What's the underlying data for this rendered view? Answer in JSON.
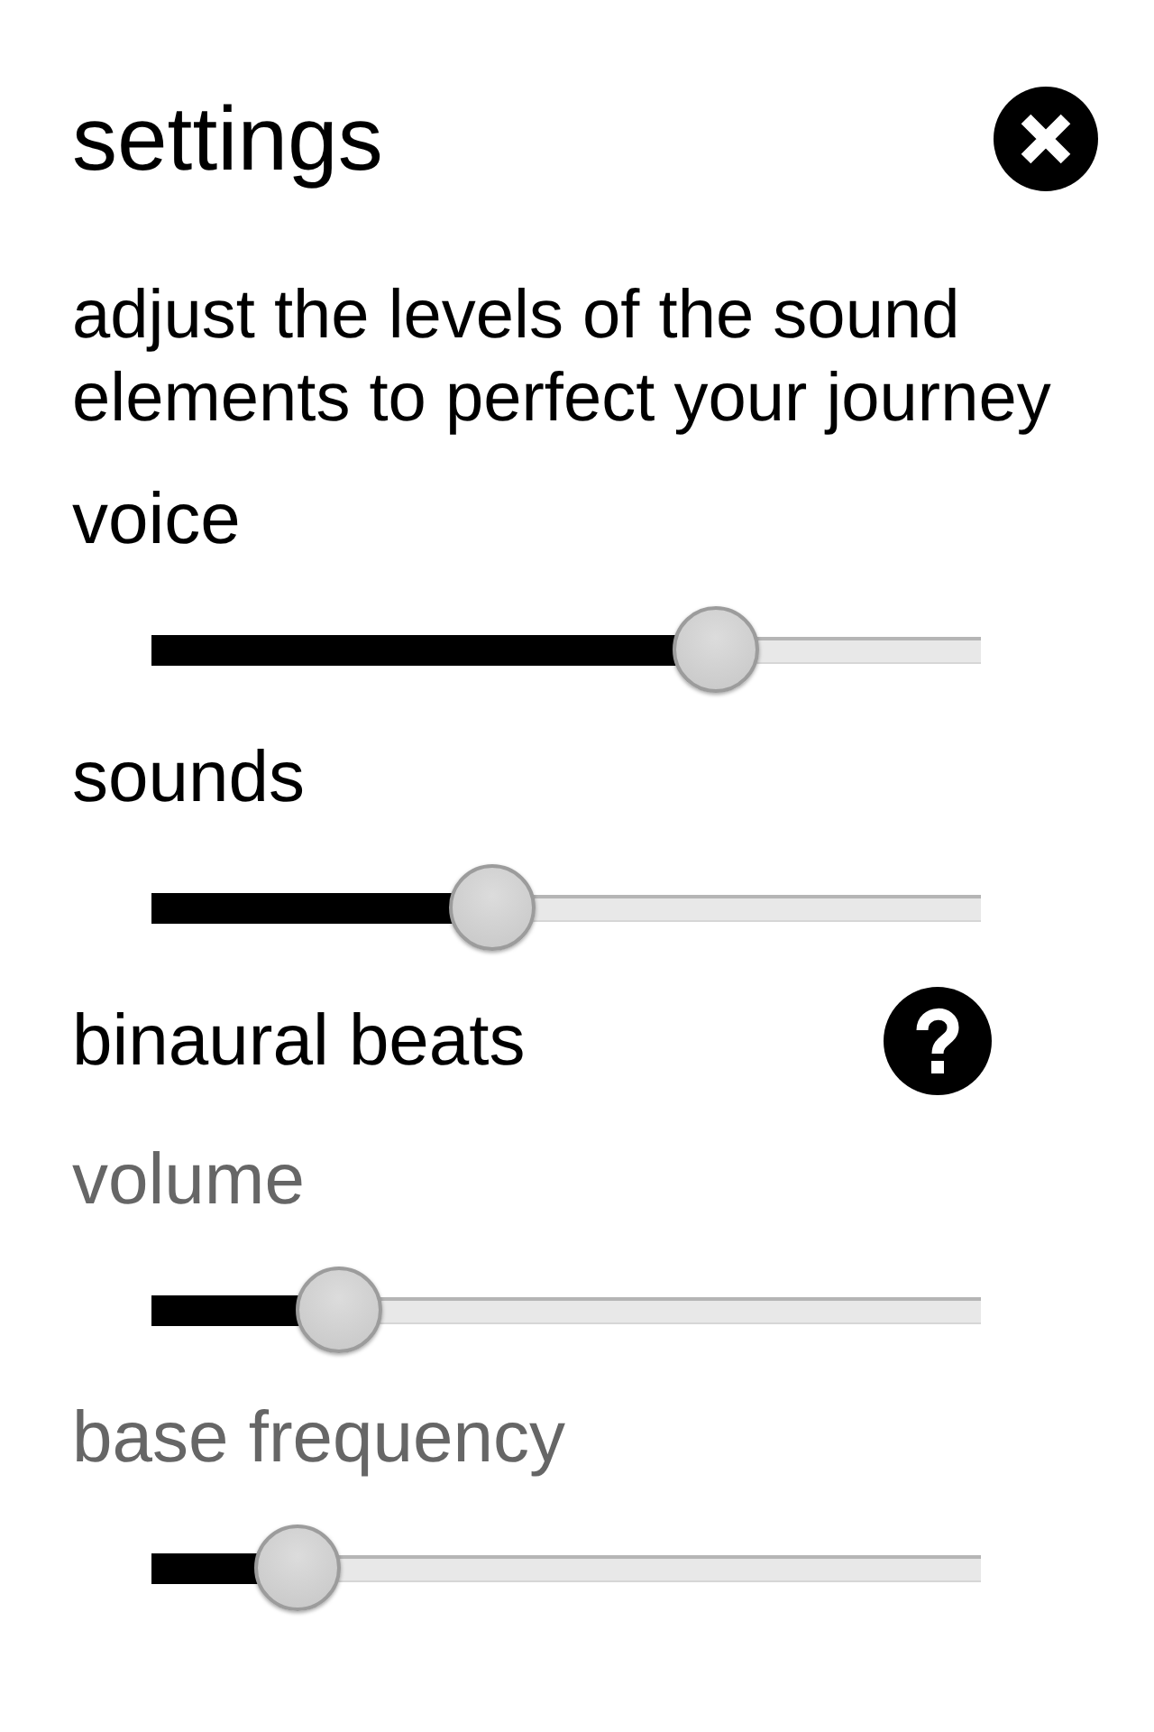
{
  "header": {
    "title": "settings"
  },
  "intro": "adjust the levels of the sound elements to perfect your journey",
  "controls": [
    {
      "kind": "slider",
      "label": "voice",
      "level": 0.68
    },
    {
      "kind": "slider",
      "label": "sounds",
      "level": 0.41
    },
    {
      "kind": "group",
      "label": "binaural beats",
      "children": [
        {
          "kind": "slider",
          "label": "volume",
          "level": 0.226
        },
        {
          "kind": "slider",
          "label": "base frequency",
          "level": 0.176
        }
      ]
    }
  ]
}
